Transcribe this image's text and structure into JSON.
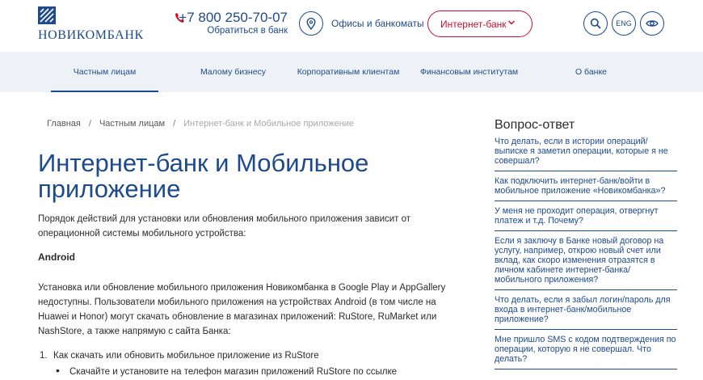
{
  "header": {
    "logo_text": "НОВИКОМБАНК",
    "phone": "+7 800 250-70-07",
    "phone_sub": "Обратиться в банк",
    "offices_label": "Офисы и банкоматы",
    "internet_bank_label": "Интернет-банк",
    "lang_label": "ENG"
  },
  "nav": {
    "items": [
      {
        "label": "Частным лицам"
      },
      {
        "label": "Малому бизнесу"
      },
      {
        "label": "Корпоративным клиентам"
      },
      {
        "label": "Финансовым институтам"
      },
      {
        "label": "О банке"
      }
    ]
  },
  "breadcrumbs": {
    "items": [
      "Главная",
      "Частным лицам"
    ],
    "current": "Интернет-банк и Мобильное приложение",
    "separator": "/"
  },
  "main": {
    "title": "Интернет-банк и Мобильное приложение",
    "intro": "Порядок действий для установки или обновления мобильного приложения зависит от операционной системы мобильного устройства:",
    "android_heading": "Android",
    "android_text": "Установка или обновление мобильного приложения Новикомбанка в Google Play и AppGallery недоступны. Пользователи мобильного приложения на устройствах Android (в том числе на Huawei и Honor) могут скачать обновление в магазинах приложений: RuStore, RuMarket или NashStore, а также напрямую с сайта Банка:",
    "ordered_item_num": "1.",
    "ordered_item": "Как скачать или обновить мобильное приложение из RuStore",
    "bullet": "•",
    "bullet_item": "Скачайте и установите на телефон магазин приложений RuStore по ссылке"
  },
  "faq": {
    "title": "Вопрос-ответ",
    "items": [
      "Что делать, если в истории операций/выписке я заметил операции, которые я не совершал?",
      "Как подключить интернет-банк/войти в мобильное приложение «Новикомбанка»?",
      "У меня не проходит операция, отвергнут платеж и т.д. Почему?",
      "Если я заключу в Банке новый договор на услугу, например, открою новый счет или вклад, как скоро изменения отразятся в личном кабинете интернет-банка/мобильного приложения?",
      "Что делать, если я забыл логин/пароль для входа в интернет-банк/мобильное приложение?",
      "Мне пришло SMS с кодом подтверждения по операции, которую я не совершал. Что делать?"
    ]
  },
  "colors": {
    "brand_blue": "#1d4a8c",
    "accent_red": "#c8102e",
    "nav_bg": "#eef2f6"
  },
  "icons": [
    "logo-mark-icon",
    "phone-icon",
    "location-pin-icon",
    "chevron-down-icon",
    "search-icon",
    "eye-icon"
  ]
}
